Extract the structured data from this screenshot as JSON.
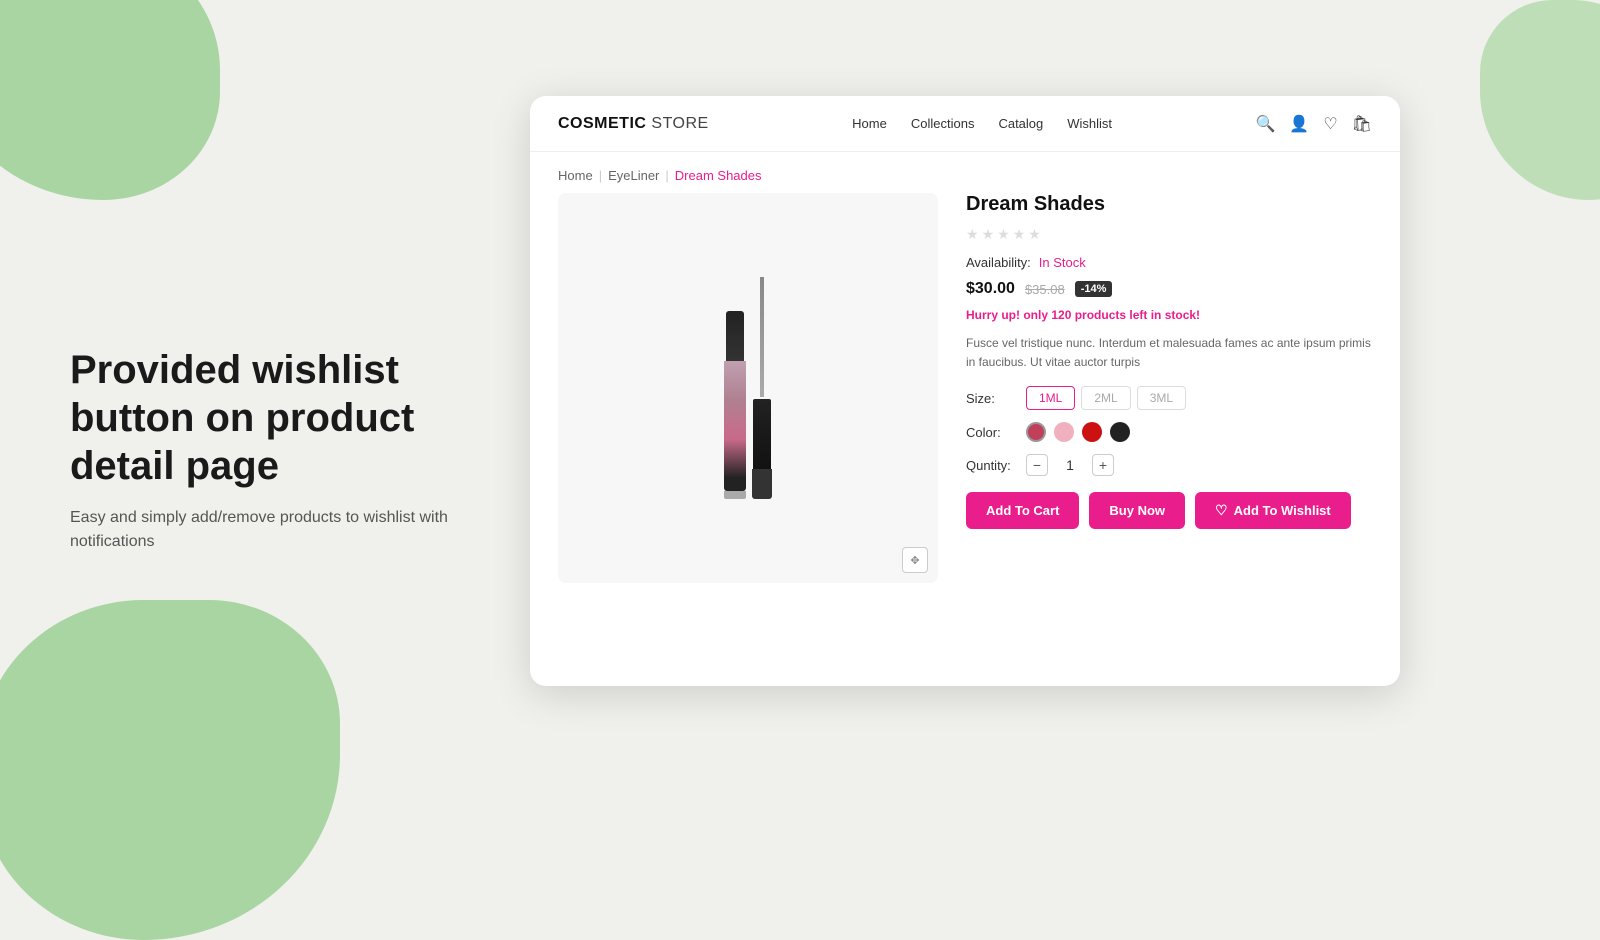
{
  "page": {
    "bg_color": "#f0f0ec",
    "blob_color": "#a8d5a2"
  },
  "left": {
    "heading": "Provided wishlist button on product detail page",
    "subtext": "Easy and simply add/remove products to wishlist with notifications"
  },
  "browser": {
    "navbar": {
      "logo_bold": "COSMETIC",
      "logo_regular": " STORE",
      "links": [
        "Home",
        "Collections",
        "Catalog",
        "Wishlist"
      ]
    },
    "breadcrumb": {
      "home": "Home",
      "category": "EyeLiner",
      "current": "Dream Shades",
      "separator": "|"
    },
    "product": {
      "title": "Dream Shades",
      "availability_label": "Availability:",
      "availability_value": "In Stock",
      "price_current": "$30.00",
      "price_original": "$35.08",
      "discount_badge": "-14%",
      "hurry_prefix": "Hurry up! only ",
      "hurry_count": "120",
      "hurry_suffix": " products left in stock!",
      "description": "Fusce vel tristique nunc. Interdum et malesuada fames ac ante ipsum primis in faucibus. Ut vitae auctor turpis",
      "size_label": "Size:",
      "sizes": [
        {
          "label": "1ML",
          "state": "active"
        },
        {
          "label": "2ML",
          "state": "inactive"
        },
        {
          "label": "3ML",
          "state": "inactive"
        }
      ],
      "color_label": "Color:",
      "colors": [
        {
          "hex": "#c0405a",
          "selected": true
        },
        {
          "hex": "#f0b0c0",
          "selected": false
        },
        {
          "hex": "#cc1111",
          "selected": false
        },
        {
          "hex": "#222222",
          "selected": false
        }
      ],
      "quantity_label": "Quntity:",
      "quantity_value": "1",
      "quantity_minus": "−",
      "quantity_plus": "+",
      "btn_add_cart": "Add To Cart",
      "btn_buy_now": "Buy Now",
      "btn_wishlist": "Add To Wishlist"
    }
  }
}
